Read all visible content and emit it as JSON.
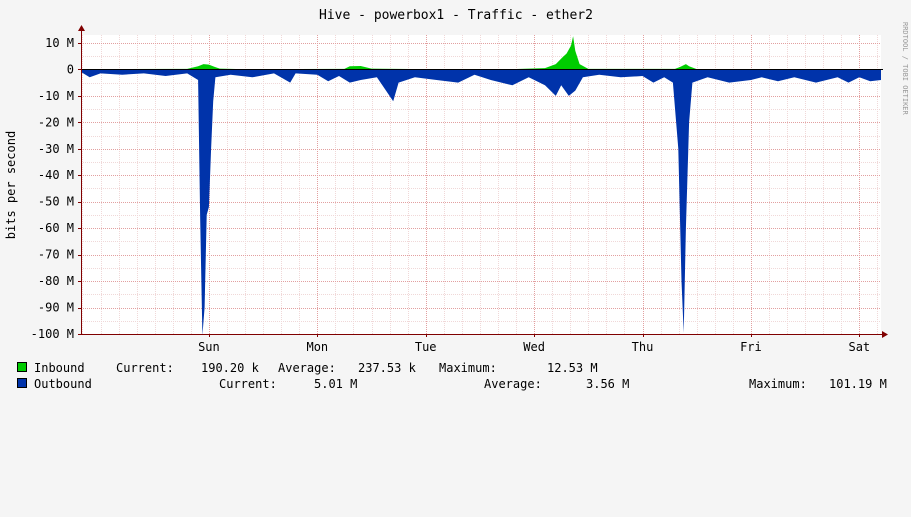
{
  "chart_data": {
    "type": "area",
    "title": "Hive - powerbox1 - Traffic - ether2",
    "ylabel": "bits per second",
    "watermark": "RRDTOOL / TOBI OETIKER",
    "ylim": [
      -100000000,
      13000000
    ],
    "yticks": [
      {
        "value": 10000000,
        "label": "10 M"
      },
      {
        "value": 0,
        "label": "0"
      },
      {
        "value": -10000000,
        "label": "-10 M"
      },
      {
        "value": -20000000,
        "label": "-20 M"
      },
      {
        "value": -30000000,
        "label": "-30 M"
      },
      {
        "value": -40000000,
        "label": "-40 M"
      },
      {
        "value": -50000000,
        "label": "-50 M"
      },
      {
        "value": -60000000,
        "label": "-60 M"
      },
      {
        "value": -70000000,
        "label": "-70 M"
      },
      {
        "value": -80000000,
        "label": "-80 M"
      },
      {
        "value": -90000000,
        "label": "-90 M"
      },
      {
        "value": -100000000,
        "label": "-100 M"
      }
    ],
    "xlim": [
      -1.18,
      6.2
    ],
    "xticks": [
      {
        "value": 0,
        "label": "Sun"
      },
      {
        "value": 1,
        "label": "Mon"
      },
      {
        "value": 2,
        "label": "Tue"
      },
      {
        "value": 3,
        "label": "Wed"
      },
      {
        "value": 4,
        "label": "Thu"
      },
      {
        "value": 5,
        "label": "Fri"
      },
      {
        "value": 6,
        "label": "Sat"
      }
    ],
    "grid": true,
    "colors": {
      "inbound": "#00cc00",
      "outbound": "#0033aa",
      "grid": "#e2a0a0",
      "axis": "#800000"
    },
    "series": [
      {
        "name": "Inbound",
        "current": "190.20 k",
        "average": "237.53 k",
        "maximum": "12.53 M",
        "points": [
          [
            -1.18,
            0.1
          ],
          [
            -0.2,
            0.2
          ],
          [
            -0.1,
            1.2
          ],
          [
            -0.05,
            2.0
          ],
          [
            0.0,
            1.8
          ],
          [
            0.05,
            1.0
          ],
          [
            0.1,
            0.3
          ],
          [
            0.3,
            0.1
          ],
          [
            1.25,
            0.2
          ],
          [
            1.3,
            1.2
          ],
          [
            1.4,
            1.3
          ],
          [
            1.5,
            0.3
          ],
          [
            2.0,
            0.1
          ],
          [
            2.8,
            0.1
          ],
          [
            3.1,
            0.5
          ],
          [
            3.2,
            2.0
          ],
          [
            3.26,
            4.5
          ],
          [
            3.3,
            6.0
          ],
          [
            3.34,
            9.0
          ],
          [
            3.36,
            12.5
          ],
          [
            3.38,
            7.0
          ],
          [
            3.42,
            2.0
          ],
          [
            3.5,
            0.2
          ],
          [
            4.3,
            0.2
          ],
          [
            4.35,
            1.0
          ],
          [
            4.4,
            2.0
          ],
          [
            4.43,
            1.2
          ],
          [
            4.5,
            0.1
          ],
          [
            6.2,
            0.1
          ]
        ]
      },
      {
        "name": "Outbound",
        "current": "5.01 M",
        "average": "3.56 M",
        "maximum": "101.19 M",
        "points": [
          [
            -1.18,
            -1.0
          ],
          [
            -1.1,
            -3.0
          ],
          [
            -1.0,
            -1.5
          ],
          [
            -0.8,
            -2.0
          ],
          [
            -0.6,
            -1.5
          ],
          [
            -0.4,
            -2.5
          ],
          [
            -0.2,
            -1.5
          ],
          [
            -0.1,
            -4.0
          ],
          [
            -0.08,
            -57.0
          ],
          [
            -0.06,
            -100.5
          ],
          [
            -0.04,
            -90.0
          ],
          [
            -0.02,
            -55.0
          ],
          [
            0.0,
            -52.0
          ],
          [
            0.02,
            -30.0
          ],
          [
            0.04,
            -12.0
          ],
          [
            0.06,
            -3.0
          ],
          [
            0.2,
            -2.0
          ],
          [
            0.4,
            -3.0
          ],
          [
            0.6,
            -1.5
          ],
          [
            0.75,
            -5.0
          ],
          [
            0.8,
            -1.5
          ],
          [
            1.0,
            -2.0
          ],
          [
            1.1,
            -4.5
          ],
          [
            1.2,
            -2.5
          ],
          [
            1.3,
            -5.0
          ],
          [
            1.4,
            -4.0
          ],
          [
            1.55,
            -3.0
          ],
          [
            1.7,
            -12.0
          ],
          [
            1.75,
            -5.0
          ],
          [
            1.9,
            -3.0
          ],
          [
            2.1,
            -4.0
          ],
          [
            2.3,
            -5.0
          ],
          [
            2.45,
            -2.0
          ],
          [
            2.6,
            -4.0
          ],
          [
            2.8,
            -6.0
          ],
          [
            2.95,
            -3.0
          ],
          [
            3.1,
            -6.0
          ],
          [
            3.2,
            -10.0
          ],
          [
            3.25,
            -6.0
          ],
          [
            3.32,
            -10.0
          ],
          [
            3.38,
            -8.0
          ],
          [
            3.45,
            -3.0
          ],
          [
            3.6,
            -2.0
          ],
          [
            3.8,
            -3.0
          ],
          [
            4.0,
            -2.5
          ],
          [
            4.1,
            -5.0
          ],
          [
            4.2,
            -3.0
          ],
          [
            4.28,
            -5.0
          ],
          [
            4.33,
            -30.0
          ],
          [
            4.36,
            -80.0
          ],
          [
            4.38,
            -99.5
          ],
          [
            4.4,
            -60.0
          ],
          [
            4.43,
            -20.0
          ],
          [
            4.46,
            -5.0
          ],
          [
            4.6,
            -3.0
          ],
          [
            4.8,
            -5.0
          ],
          [
            5.0,
            -4.0
          ],
          [
            5.1,
            -3.0
          ],
          [
            5.25,
            -4.5
          ],
          [
            5.4,
            -3.0
          ],
          [
            5.6,
            -5.0
          ],
          [
            5.8,
            -3.0
          ],
          [
            5.9,
            -5.0
          ],
          [
            6.0,
            -3.0
          ],
          [
            6.1,
            -4.5
          ],
          [
            6.2,
            -4.0
          ]
        ]
      }
    ]
  },
  "legend": {
    "current_label": "Current:",
    "average_label": "Average:",
    "maximum_label": "Maximum:"
  }
}
